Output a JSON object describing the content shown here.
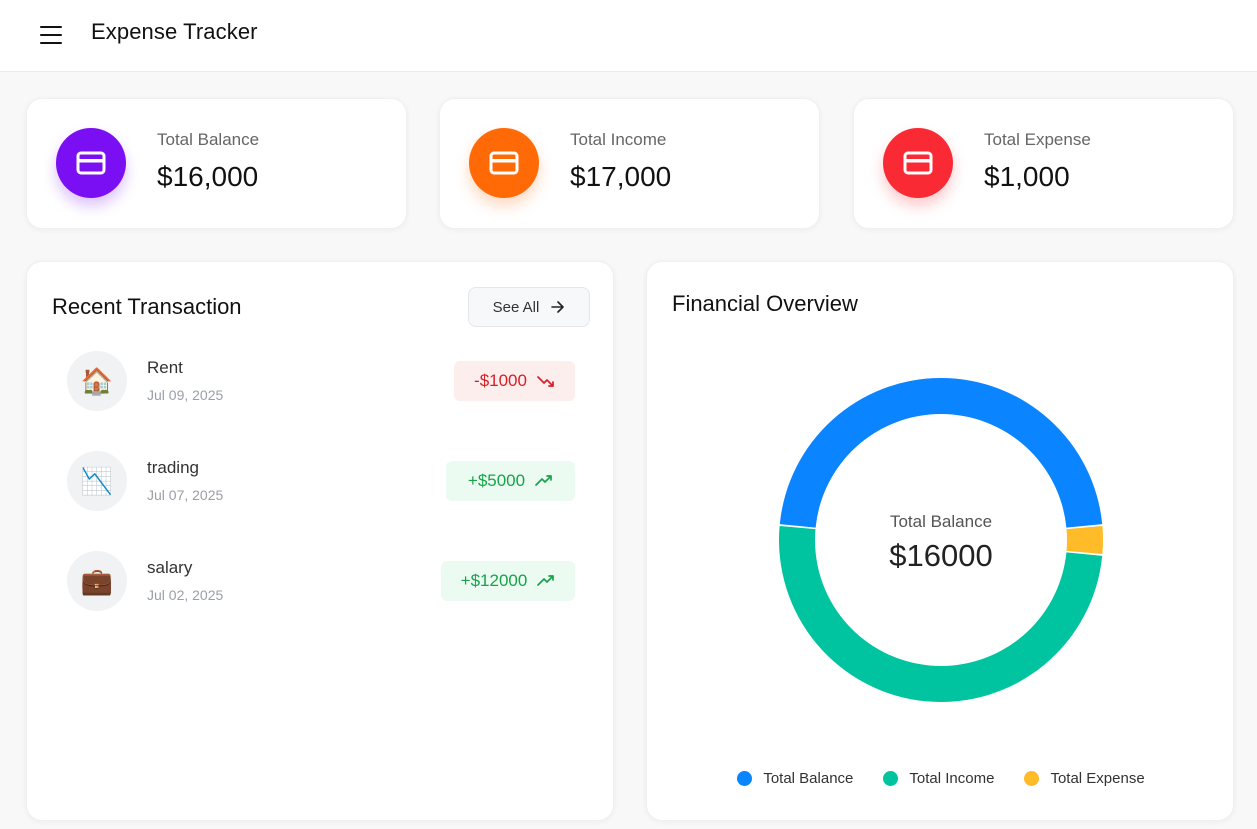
{
  "header": {
    "title": "Expense Tracker",
    "menu_icon": "hamburger-menu-icon"
  },
  "stats": [
    {
      "label": "Total Balance",
      "value": "$16,000",
      "color": "#7b0ff3",
      "icon": "credit-card-icon"
    },
    {
      "label": "Total Income",
      "value": "$17,000",
      "color": "#ff6a06",
      "icon": "credit-card-icon"
    },
    {
      "label": "Total Expense",
      "value": "$1,000",
      "color": "#fa2a35",
      "icon": "credit-card-icon"
    }
  ],
  "transactions": {
    "title": "Recent Transaction",
    "see_all": "See All",
    "items": [
      {
        "name": "Rent",
        "date": "Jul 09, 2025",
        "amount": "-$1000",
        "type": "expense",
        "icon": "🏠"
      },
      {
        "name": "trading",
        "date": "Jul 07, 2025",
        "amount": "+$5000",
        "type": "income",
        "icon": "📉"
      },
      {
        "name": "salary",
        "date": "Jul 02, 2025",
        "amount": "+$12000",
        "type": "income",
        "icon": "💼"
      }
    ]
  },
  "overview": {
    "title": "Financial Overview",
    "center_label": "Total Balance",
    "center_value": "$16000",
    "legend": [
      {
        "label": "Total Balance",
        "color": "#0a84ff"
      },
      {
        "label": "Total Income",
        "color": "#00c49f"
      },
      {
        "label": "Total Expense",
        "color": "#ffbb28"
      }
    ]
  },
  "chart_data": {
    "type": "pie",
    "categories": [
      "Total Balance",
      "Total Income",
      "Total Expense"
    ],
    "values": [
      16000,
      17000,
      1000
    ],
    "colors": [
      "#0a84ff",
      "#00c49f",
      "#ffbb28"
    ],
    "title": "Financial Overview"
  }
}
